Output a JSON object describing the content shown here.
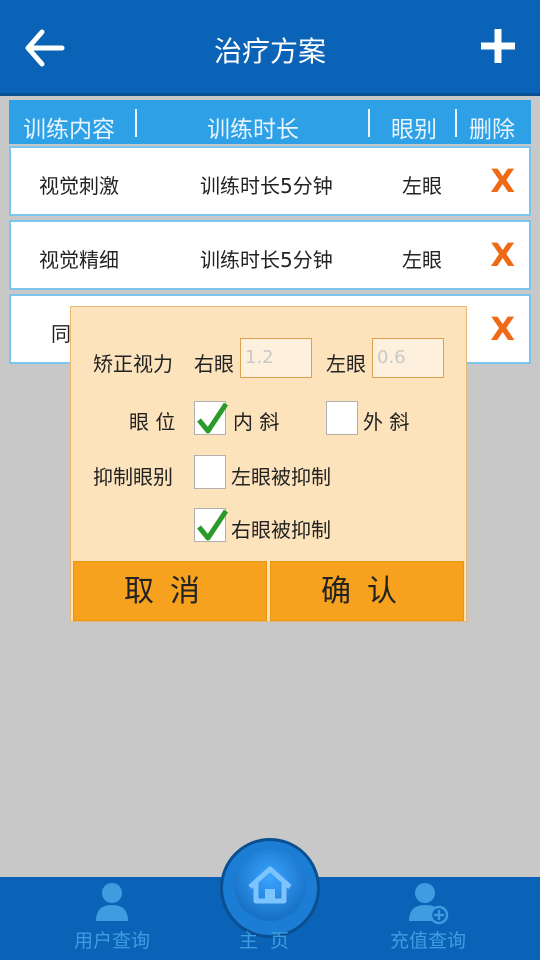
{
  "header": {
    "title": "治疗方案"
  },
  "table": {
    "columns": [
      "训练内容",
      "训练时长",
      "眼别",
      "删除"
    ],
    "rows": [
      {
        "content": "视觉刺激",
        "duration": "训练时长5分钟",
        "eye": "左眼",
        "delete": "X"
      },
      {
        "content": "视觉精细",
        "duration": "训练时长5分钟",
        "eye": "左眼",
        "delete": "X"
      },
      {
        "content": "同",
        "duration": "",
        "eye": "",
        "delete": "X"
      }
    ]
  },
  "dialog": {
    "corrected_vision_label": "矫正视力",
    "right_eye_label": "右眼",
    "right_eye_placeholder": "1.2",
    "left_eye_label": "左眼",
    "left_eye_placeholder": "0.6",
    "eye_position_label": "眼 位",
    "esotropia_label": "内 斜",
    "esotropia_checked": true,
    "exotropia_label": "外 斜",
    "exotropia_checked": false,
    "suppression_label": "抑制眼别",
    "left_suppressed_label": "左眼被抑制",
    "left_suppressed_checked": false,
    "right_suppressed_label": "右眼被抑制",
    "right_suppressed_checked": true,
    "cancel_label": "取消",
    "confirm_label": "确认"
  },
  "bottom_nav": {
    "user_query": "用户查询",
    "home": "主页",
    "recharge_query": "充值查询"
  },
  "colors": {
    "primary": "#0a63b6",
    "header_row": "#2ea0e6",
    "accent_orange": "#f7a21f",
    "delete_orange": "#ef6a16",
    "check_green": "#2a9b2a"
  }
}
